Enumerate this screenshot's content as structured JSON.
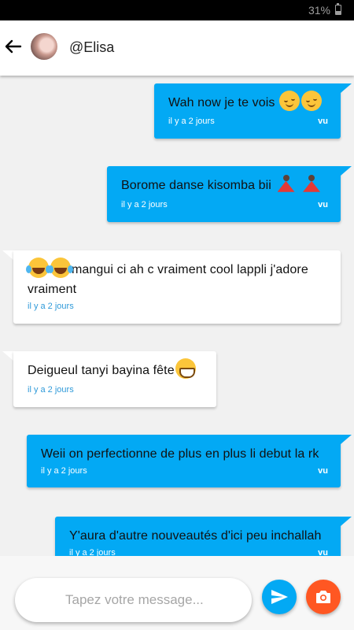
{
  "status_bar": {
    "battery": "31%"
  },
  "header": {
    "contact_name": "@Elisa"
  },
  "messages": [
    {
      "direction": "sent",
      "text": "Wah now je te vois",
      "emojis": [
        "relieved-face",
        "relieved-face"
      ],
      "time": "il y a 2 jours",
      "status": "vu"
    },
    {
      "direction": "sent",
      "text": "Borome danse kisomba bii",
      "emojis": [
        "dancer",
        "dancer"
      ],
      "time": "il y a 2 jours",
      "status": "vu"
    },
    {
      "direction": "recv",
      "text": "mangui ci ah c vraiment cool lappli j'adore vraiment",
      "emojis_before": [
        "tears-of-joy",
        "tears-of-joy"
      ],
      "time": "il y a 2 jours"
    },
    {
      "direction": "recv",
      "text": "Deigueul tanyi bayina fête",
      "emojis": [
        "grinning-face"
      ],
      "time": "il y a 2 jours"
    },
    {
      "direction": "sent",
      "text": "Weii on perfectionne de plus en plus li debut la rk",
      "time": "il y a 2 jours",
      "status": "vu"
    },
    {
      "direction": "sent",
      "text": "Y'aura d'autre nouveautés d'ici peu inchallah",
      "time": "il y a 2 jours",
      "status": "vu"
    }
  ],
  "composer": {
    "placeholder": "Tapez votre message...",
    "value": ""
  },
  "colors": {
    "sent_bubble": "#03a9f4",
    "recv_bubble": "#ffffff",
    "send_button": "#03a9f4",
    "camera_button": "#ff5722"
  },
  "icons": {
    "back": "arrow-left-icon",
    "send": "send-icon",
    "camera": "camera-icon"
  }
}
